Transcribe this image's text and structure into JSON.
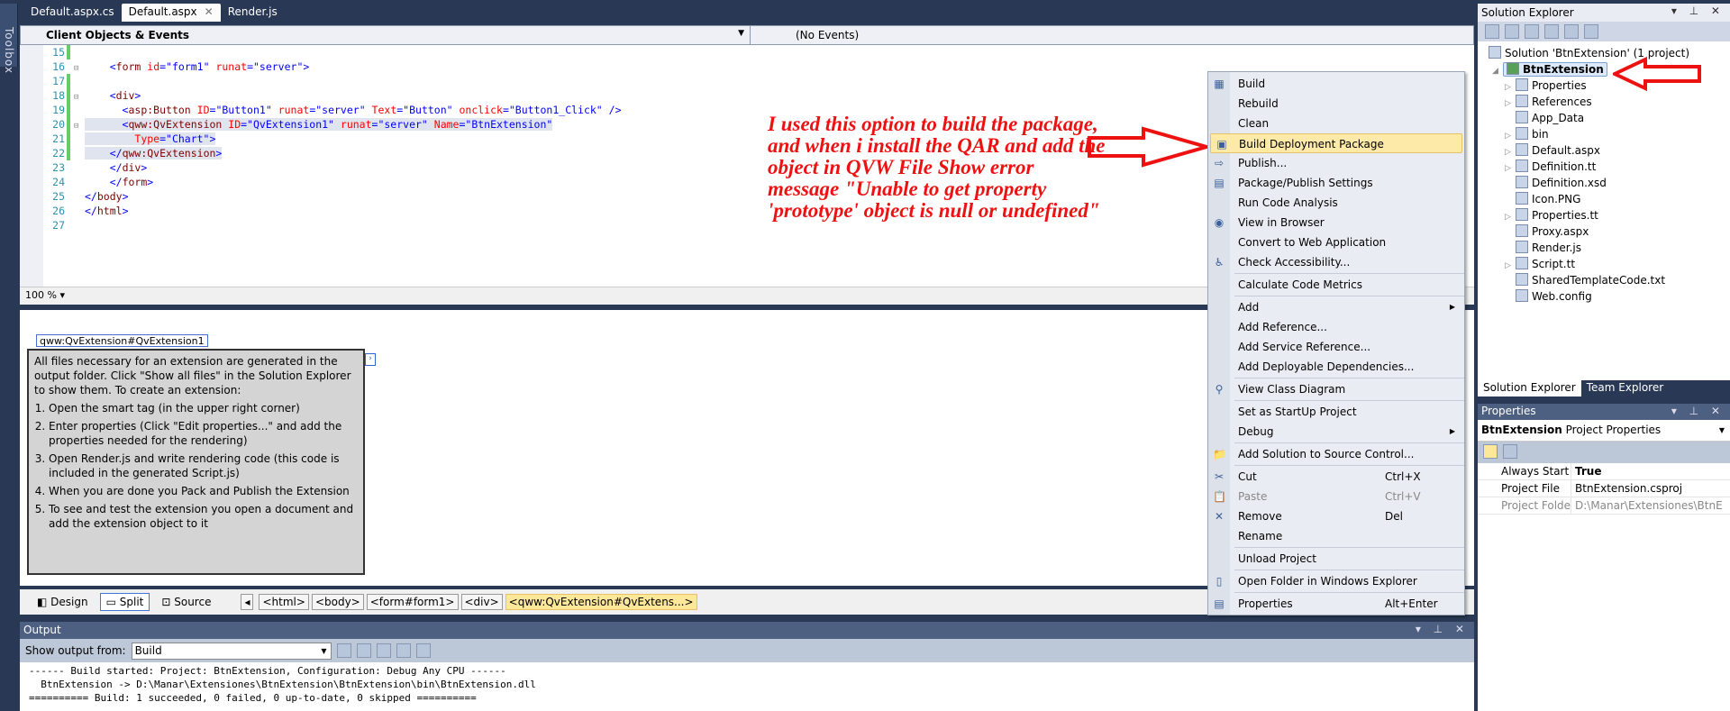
{
  "toolbox": {
    "label": "Toolbox"
  },
  "tabs": [
    {
      "label": "Default.aspx.cs"
    },
    {
      "label": "Default.aspx",
      "active": true
    },
    {
      "label": "Render.js"
    }
  ],
  "navbar": {
    "objects": "Client Objects & Events",
    "events": "(No Events)"
  },
  "code": [
    {
      "n": "15",
      "chg": true,
      "fold": "",
      "hl": false,
      "tok": []
    },
    {
      "n": "16",
      "chg": false,
      "fold": "⊟",
      "tok": [
        [
          "    ",
          ""
        ],
        [
          "<",
          "b"
        ],
        [
          "form",
          "m"
        ],
        [
          " id",
          "r"
        ],
        [
          "=\"form1\"",
          "b"
        ],
        [
          " runat",
          "r"
        ],
        [
          "=\"server\"",
          "b"
        ],
        [
          ">",
          "b"
        ]
      ]
    },
    {
      "n": "17",
      "chg": true,
      "fold": "",
      "tok": []
    },
    {
      "n": "18",
      "chg": true,
      "fold": "⊟",
      "tok": [
        [
          "    ",
          ""
        ],
        [
          "<",
          "b"
        ],
        [
          "div",
          "m"
        ],
        [
          ">",
          "b"
        ]
      ]
    },
    {
      "n": "19",
      "chg": true,
      "fold": "",
      "tok": [
        [
          "      ",
          ""
        ],
        [
          "<",
          "b"
        ],
        [
          "asp:Button",
          "m"
        ],
        [
          " ID",
          "r"
        ],
        [
          "=\"Button1\"",
          "b"
        ],
        [
          " runat",
          "r"
        ],
        [
          "=\"server\"",
          "b"
        ],
        [
          " Text",
          "r"
        ],
        [
          "=\"Button\"",
          "b"
        ],
        [
          " onclick",
          "r"
        ],
        [
          "=\"Button1_Click\"",
          "b"
        ],
        [
          " />",
          "b"
        ]
      ]
    },
    {
      "n": "20",
      "chg": true,
      "fold": "⊟",
      "tok": [
        [
          "      ",
          ""
        ],
        [
          "<",
          "b"
        ],
        [
          "qww:QvExtension",
          "m"
        ],
        [
          " ID",
          "r"
        ],
        [
          "=\"QvExtension1\"",
          "b"
        ],
        [
          " runat",
          "r"
        ],
        [
          "=\"server\"",
          "b"
        ],
        [
          " Name",
          "r"
        ],
        [
          "=\"BtnExtension\"",
          "b"
        ]
      ]
    },
    {
      "n": "21",
      "chg": true,
      "fold": "",
      "tok": [
        [
          "        ",
          ""
        ],
        [
          "Type",
          "r"
        ],
        [
          "=\"Chart\"",
          "b"
        ],
        [
          ">",
          "b"
        ]
      ]
    },
    {
      "n": "22",
      "chg": true,
      "fold": "",
      "tok": [
        [
          "    ",
          ""
        ],
        [
          "</",
          "b"
        ],
        [
          "qww:QvExtension",
          "m"
        ],
        [
          ">",
          "b"
        ]
      ]
    },
    {
      "n": "23",
      "chg": false,
      "fold": "",
      "tok": [
        [
          "    ",
          ""
        ],
        [
          "</",
          "b"
        ],
        [
          "div",
          "m"
        ],
        [
          ">",
          "b"
        ]
      ]
    },
    {
      "n": "24",
      "chg": false,
      "fold": "",
      "tok": [
        [
          "    ",
          ""
        ],
        [
          "</",
          "b"
        ],
        [
          "form",
          "m"
        ],
        [
          ">",
          "b"
        ]
      ]
    },
    {
      "n": "25",
      "chg": false,
      "fold": "",
      "tok": [
        [
          "",
          ""
        ],
        [
          "</",
          "b"
        ],
        [
          "body",
          "m"
        ],
        [
          ">",
          "b"
        ]
      ]
    },
    {
      "n": "26",
      "chg": false,
      "fold": "",
      "tok": [
        [
          "",
          ""
        ],
        [
          "</",
          "b"
        ],
        [
          "html",
          "m"
        ],
        [
          ">",
          "b"
        ]
      ]
    },
    {
      "n": "27",
      "chg": false,
      "fold": "",
      "tok": []
    }
  ],
  "zoom": "100 %",
  "design": {
    "tag": "qww:QvExtension#QvExtension1",
    "intro": "All files necessary for an extension are generated in the output folder. Click \"Show all files\" in the Solution Explorer to show them. To create an extension:",
    "steps": [
      "Open the smart tag (in the upper right corner)",
      "Enter properties (Click \"Edit properties...\" and add the properties needed for the rendering)",
      "Open Render.js and write rendering code (this code is included in the generated Script.js)",
      "When you are done you Pack and Publish the Extension",
      "To see and test the extension you open a document and add the extension object to it"
    ]
  },
  "viewbar": {
    "design": "Design",
    "split": "Split",
    "source": "Source",
    "crumbs": [
      "<html>",
      "<body>",
      "<form#form1>",
      "<div>",
      "<qww:QvExtension#QvExtens...>"
    ]
  },
  "output": {
    "title": "Output",
    "show_from": "Show output from:",
    "source": "Build",
    "lines": [
      "------ Build started: Project: BtnExtension, Configuration: Debug Any CPU ------",
      "  BtnExtension -> D:\\Manar\\Extensiones\\BtnExtension\\BtnExtension\\bin\\BtnExtension.dll",
      "========== Build: 1 succeeded, 0 failed, 0 up-to-date, 0 skipped =========="
    ]
  },
  "solution_explorer": {
    "title": "Solution Explorer",
    "solution": "Solution 'BtnExtension' (1 project)",
    "project": "BtnExtension",
    "items": [
      {
        "label": "Properties",
        "exp": true
      },
      {
        "label": "References",
        "exp": true
      },
      {
        "label": "App_Data",
        "exp": false
      },
      {
        "label": "bin",
        "exp": true
      },
      {
        "label": "Default.aspx",
        "exp": true
      },
      {
        "label": "Definition.tt",
        "exp": true
      },
      {
        "label": "Definition.xsd",
        "exp": false
      },
      {
        "label": "Icon.PNG",
        "exp": false
      },
      {
        "label": "Properties.tt",
        "exp": true
      },
      {
        "label": "Proxy.aspx",
        "exp": false
      },
      {
        "label": "Render.js",
        "exp": false
      },
      {
        "label": "Script.tt",
        "exp": true
      },
      {
        "label": "SharedTemplateCode.txt",
        "exp": false
      },
      {
        "label": "Web.config",
        "exp": false
      }
    ],
    "tabs": [
      "Solution Explorer",
      "Team Explorer"
    ]
  },
  "properties": {
    "title": "Properties",
    "object": "BtnExtension",
    "object_type": "Project Properties",
    "rows": [
      {
        "name": "Always Start When D",
        "value": "True",
        "bold": true
      },
      {
        "name": "Project File",
        "value": "BtnExtension.csproj"
      },
      {
        "name": "Project Folder",
        "value": "D:\\Manar\\Extensiones\\BtnE",
        "dim": true
      }
    ]
  },
  "menu": [
    {
      "label": "Build",
      "icon": "build-icon"
    },
    {
      "label": "Rebuild"
    },
    {
      "label": "Clean"
    },
    {
      "label": "Build Deployment Package",
      "icon": "package-icon",
      "hot": true
    },
    {
      "label": "Publish...",
      "icon": "publish-icon"
    },
    {
      "label": "Package/Publish Settings",
      "icon": "settings-icon"
    },
    {
      "label": "Run Code Analysis"
    },
    {
      "label": "View in Browser",
      "icon": "browser-icon"
    },
    {
      "label": "Convert to Web Application"
    },
    {
      "label": "Check Accessibility...",
      "icon": "accessibility-icon",
      "sep": true
    },
    {
      "label": "Calculate Code Metrics",
      "sep": true
    },
    {
      "label": "Add",
      "sub": true
    },
    {
      "label": "Add Reference..."
    },
    {
      "label": "Add Service Reference..."
    },
    {
      "label": "Add Deployable Dependencies...",
      "sep": true
    },
    {
      "label": "View Class Diagram",
      "icon": "class-diagram-icon",
      "sep": true
    },
    {
      "label": "Set as StartUp Project"
    },
    {
      "label": "Debug",
      "sub": true,
      "sep": true
    },
    {
      "label": "Add Solution to Source Control...",
      "icon": "folder-add-icon",
      "sep": true
    },
    {
      "label": "Cut",
      "icon": "scissors-icon",
      "shortcut": "Ctrl+X"
    },
    {
      "label": "Paste",
      "icon": "paste-icon",
      "shortcut": "Ctrl+V",
      "disabled": true
    },
    {
      "label": "Remove",
      "icon": "x-icon",
      "shortcut": "Del"
    },
    {
      "label": "Rename",
      "sep": true
    },
    {
      "label": "Unload Project",
      "sep": true
    },
    {
      "label": "Open Folder in Windows Explorer",
      "icon": "open-folder-icon",
      "sep": true
    },
    {
      "label": "Properties",
      "icon": "properties-icon",
      "shortcut": "Alt+Enter"
    }
  ],
  "annotation": {
    "text": "I used this option to build the package, and when i install the QAR and add the object in QVW File Show error message \"Unable to get property 'prototype'  object is null or undefined\"",
    "color": "#ee1111"
  }
}
